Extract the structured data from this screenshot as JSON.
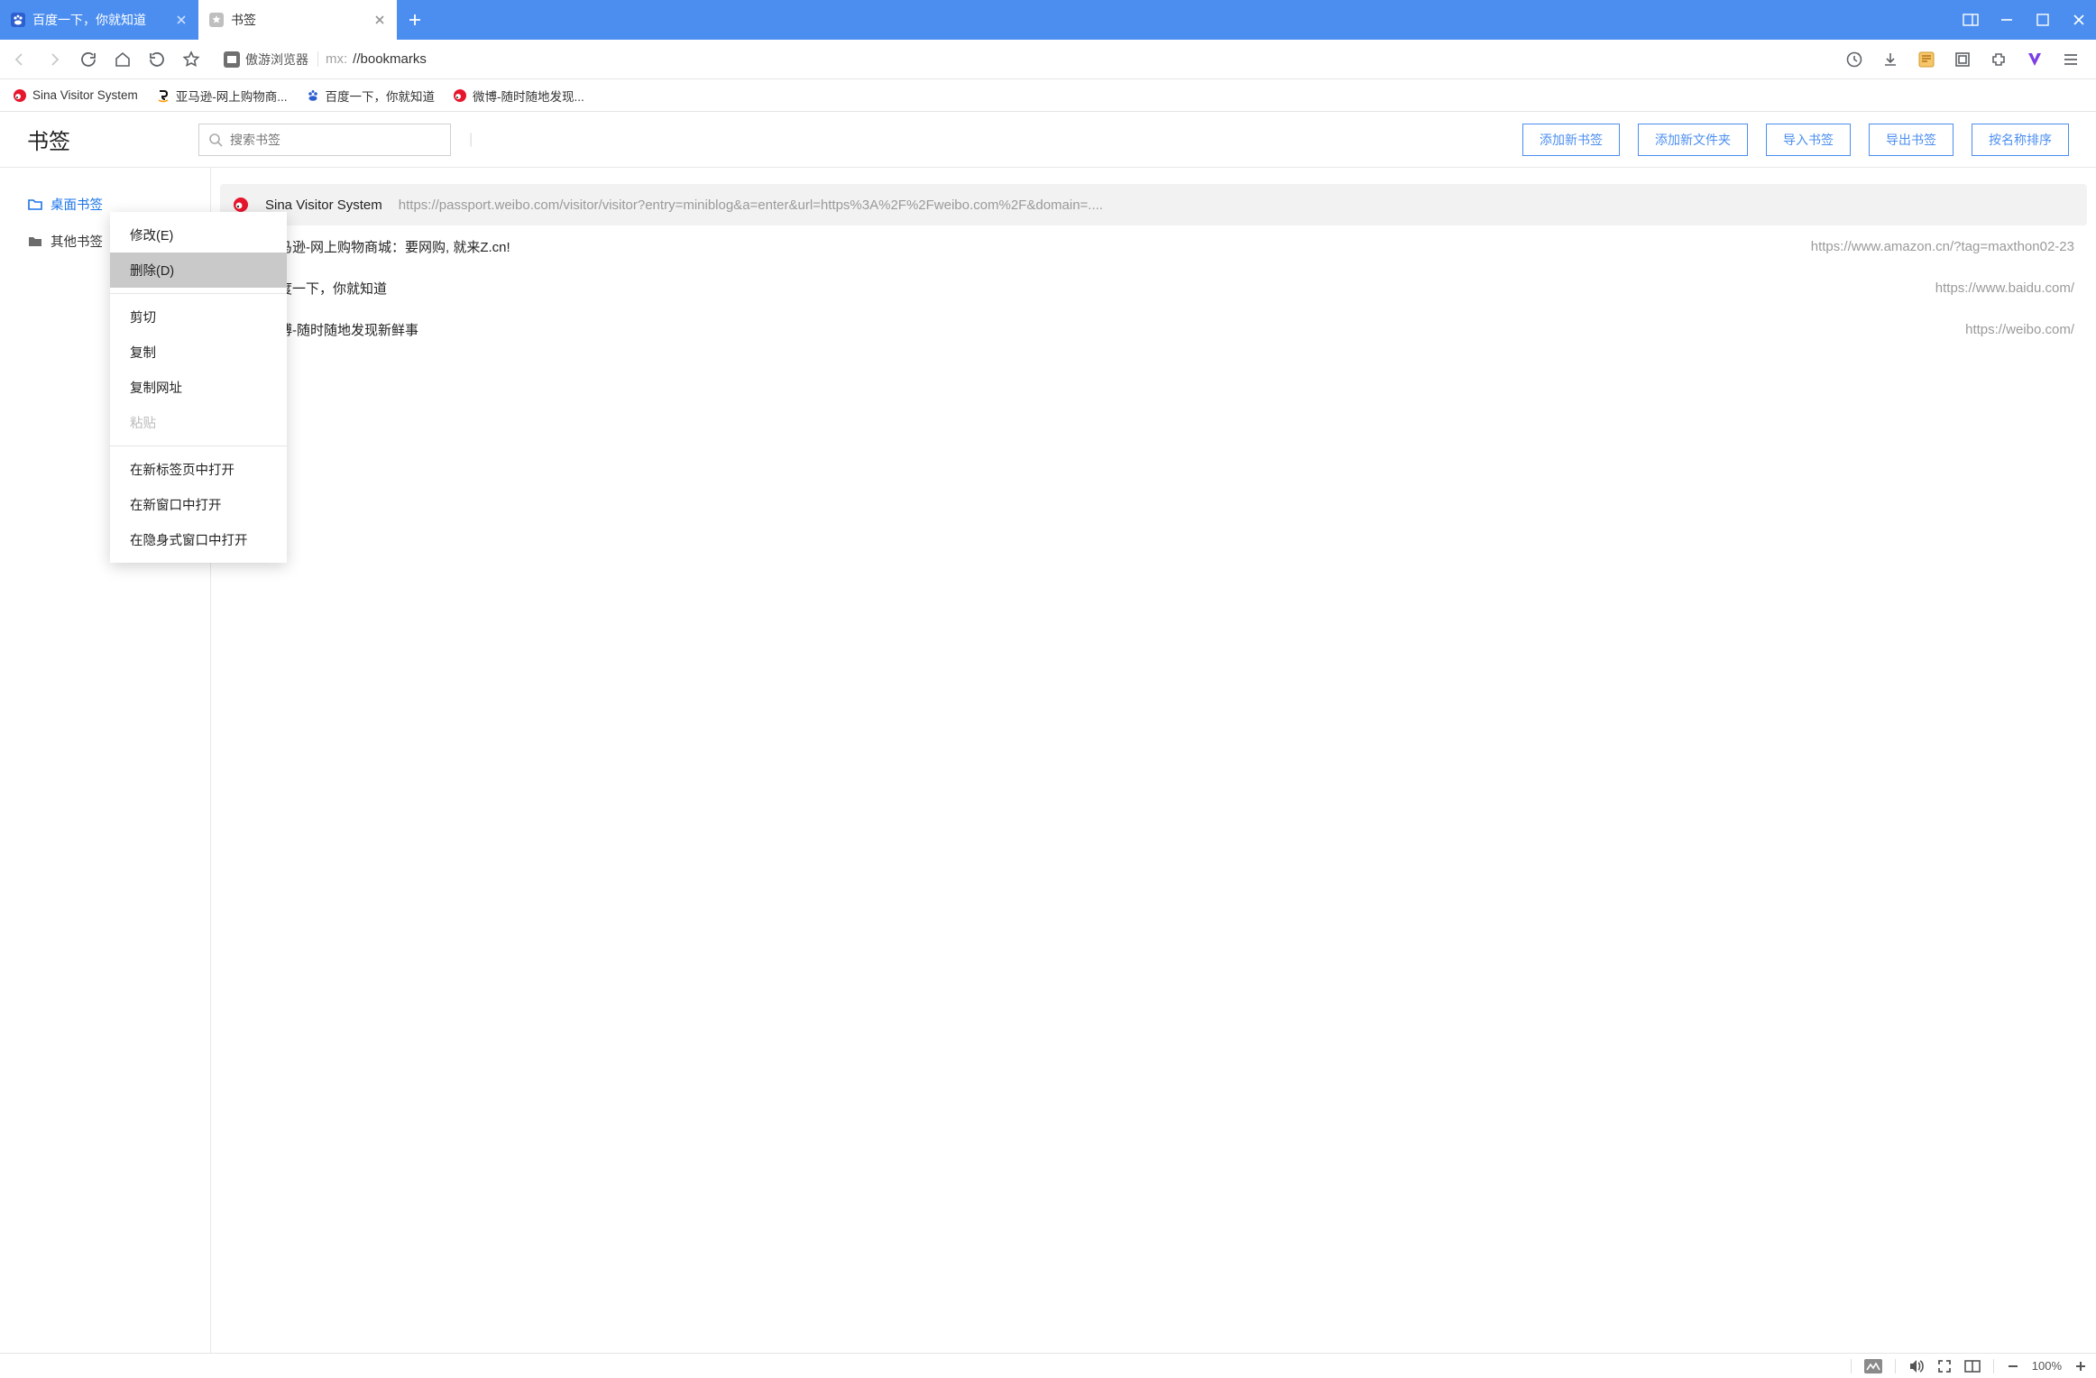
{
  "tabs": [
    {
      "title": "百度一下，你就知道",
      "active": false
    },
    {
      "title": "书签",
      "active": true
    }
  ],
  "toolbar": {
    "site_label": "傲游浏览器",
    "url_scheme": "mx:",
    "url_path": "//bookmarks"
  },
  "bookmarks_bar": [
    {
      "label": "Sina Visitor System",
      "icon": "weibo"
    },
    {
      "label": "亚马逊-网上购物商...",
      "icon": "amazon"
    },
    {
      "label": "百度一下，你就知道",
      "icon": "baidu"
    },
    {
      "label": "微博-随时随地发现...",
      "icon": "weibo"
    }
  ],
  "page": {
    "title": "书签",
    "search_placeholder": "搜索书签",
    "buttons": {
      "add_bookmark": "添加新书签",
      "add_folder": "添加新文件夹",
      "import": "导入书签",
      "export": "导出书签",
      "sort": "按名称排序"
    }
  },
  "sidebar": {
    "items": [
      {
        "label": "桌面书签",
        "active": true,
        "icon": "folder-outline"
      },
      {
        "label": "其他书签",
        "active": false,
        "icon": "folder-solid"
      }
    ]
  },
  "rows": [
    {
      "name": "Sina Visitor System",
      "url": "https://passport.weibo.com/visitor/visitor?entry=miniblog&a=enter&url=https%3A%2F%2Fweibo.com%2F&domain=....",
      "icon": "weibo",
      "url_align": "left"
    },
    {
      "name": "亚马逊-网上购物商城：要网购, 就来Z.cn!",
      "url": "https://www.amazon.cn/?tag=maxthon02-23",
      "icon": "amazon",
      "url_align": "right"
    },
    {
      "name": "百度一下，你就知道",
      "url": "https://www.baidu.com/",
      "icon": "baidu",
      "url_align": "right"
    },
    {
      "name": "微博-随时随地发现新鲜事",
      "url": "https://weibo.com/",
      "icon": "weibo",
      "url_align": "right"
    }
  ],
  "context_menu": {
    "items": [
      {
        "label": "修改(E)",
        "type": "item"
      },
      {
        "label": "删除(D)",
        "type": "item",
        "highlight": true
      },
      {
        "type": "sep"
      },
      {
        "label": "剪切",
        "type": "item"
      },
      {
        "label": "复制",
        "type": "item"
      },
      {
        "label": "复制网址",
        "type": "item"
      },
      {
        "label": "粘贴",
        "type": "item",
        "disabled": true
      },
      {
        "type": "sep"
      },
      {
        "label": "在新标签页中打开",
        "type": "item"
      },
      {
        "label": "在新窗口中打开",
        "type": "item"
      },
      {
        "label": "在隐身式窗口中打开",
        "type": "item"
      }
    ]
  },
  "statusbar": {
    "zoom": "100%"
  }
}
